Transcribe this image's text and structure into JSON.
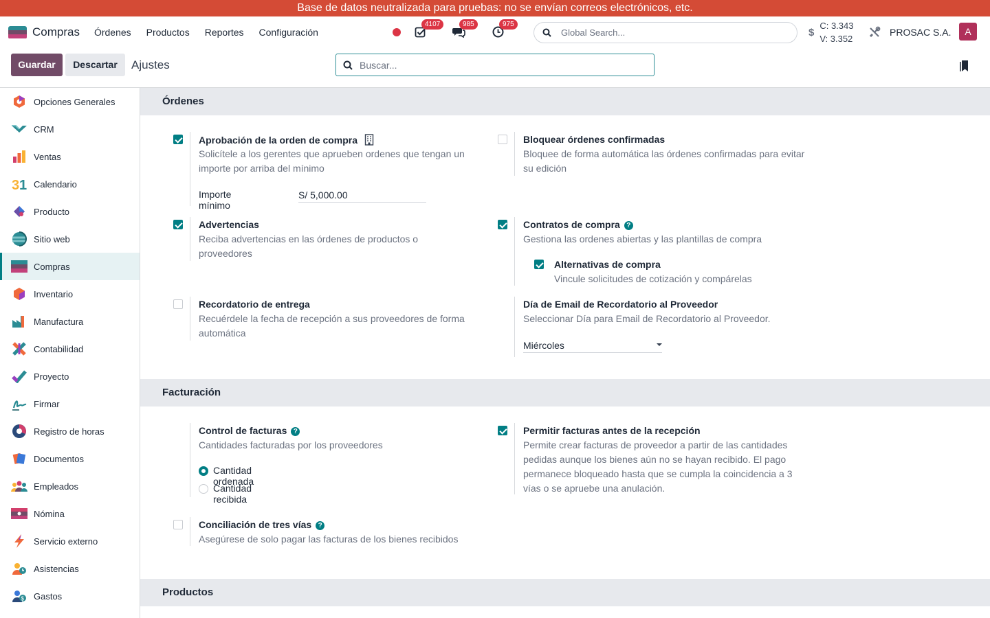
{
  "banner": {
    "text": "Base de datos neutralizada para pruebas: no se envían correos electrónicos, etc."
  },
  "navbar": {
    "app_name": "Compras",
    "menu": [
      "Órdenes",
      "Productos",
      "Reportes",
      "Configuración"
    ],
    "badges": {
      "activities": "4107",
      "messages": "985",
      "clock": "975"
    },
    "global_search_placeholder": "Global Search...",
    "currency_symbol": "$",
    "rate_buy": "C: 3.343",
    "rate_sell": "V: 3.352",
    "company": "PROSAC S.A.",
    "avatar_initial": "A"
  },
  "controlbar": {
    "save": "Guardar",
    "discard": "Descartar",
    "breadcrumb": "Ajustes",
    "search_placeholder": "Buscar..."
  },
  "sidebar": {
    "items": [
      {
        "label": "Opciones Generales",
        "icon": "general-options-icon"
      },
      {
        "label": "CRM",
        "icon": "crm-icon"
      },
      {
        "label": "Ventas",
        "icon": "sales-icon"
      },
      {
        "label": "Calendario",
        "icon": "calendar-icon"
      },
      {
        "label": "Producto",
        "icon": "product-icon"
      },
      {
        "label": "Sitio web",
        "icon": "website-icon"
      },
      {
        "label": "Compras",
        "icon": "purchase-icon"
      },
      {
        "label": "Inventario",
        "icon": "inventory-icon"
      },
      {
        "label": "Manufactura",
        "icon": "manufacturing-icon"
      },
      {
        "label": "Contabilidad",
        "icon": "accounting-icon"
      },
      {
        "label": "Proyecto",
        "icon": "project-icon"
      },
      {
        "label": "Firmar",
        "icon": "sign-icon"
      },
      {
        "label": "Registro de horas",
        "icon": "timesheet-icon"
      },
      {
        "label": "Documentos",
        "icon": "documents-icon"
      },
      {
        "label": "Empleados",
        "icon": "employees-icon"
      },
      {
        "label": "Nómina",
        "icon": "payroll-icon"
      },
      {
        "label": "Servicio externo",
        "icon": "field-service-icon"
      },
      {
        "label": "Asistencias",
        "icon": "attendances-icon"
      },
      {
        "label": "Gastos",
        "icon": "expenses-icon"
      }
    ],
    "active": "Compras"
  },
  "sections": {
    "orders": {
      "title": "Órdenes",
      "po_approval": {
        "title": "Aprobación de la orden de compra",
        "desc": "Solicítele a los gerentes que aprueben ordenes que tengan un importe por arriba del mínimo",
        "checked": true,
        "min_label": "Importe mínimo",
        "min_value": "S/ 5,000.00"
      },
      "lock_orders": {
        "title": "Bloquear órdenes confirmadas",
        "desc": "Bloquee de forma automática las órdenes confirmadas para evitar su edición",
        "checked": false
      },
      "warnings": {
        "title": "Advertencias",
        "desc": "Reciba advertencias en las órdenes de productos o proveedores",
        "checked": true
      },
      "agreements": {
        "title": "Contratos de compra",
        "desc": "Gestiona las ordenes abiertas y las plantillas de compra",
        "checked": true
      },
      "alternatives": {
        "title": "Alternativas de compra",
        "desc": "Vincule solicitudes de cotización y compárelas",
        "checked": true
      },
      "receipt_reminder": {
        "title": "Recordatorio de entrega",
        "desc": "Recuérdele la fecha de recepción a sus proveedores de forma automática",
        "checked": false
      },
      "reminder_day": {
        "title": "Día de Email de Recordatorio al Proveedor",
        "desc": "Seleccionar Día para Email de Recordatorio al Proveedor.",
        "value": "Miércoles"
      }
    },
    "billing": {
      "title": "Facturación",
      "bill_control": {
        "title": "Control de facturas",
        "desc": "Cantidades facturadas por los proveedores",
        "options": [
          "Cantidad ordenada",
          "Cantidad recibida"
        ],
        "selected": "Cantidad ordenada"
      },
      "bills_before_receipt": {
        "title": "Permitir facturas antes de la recepción",
        "desc": "Permite crear facturas de proveedor a partir de las cantidades pedidas aunque los bienes aún no se hayan recibido. El pago permanece bloqueado hasta que se cumpla la coincidencia a 3 vías o se apruebe una anulación.",
        "checked": true
      },
      "three_way": {
        "title": "Conciliación de tres vías",
        "desc": "Asegúrese de solo pagar las facturas de los bienes recibidos",
        "checked": false
      }
    },
    "products": {
      "title": "Productos"
    }
  },
  "colors": {
    "primary": "#714b67",
    "accent": "#017e84",
    "banner": "#d44b36",
    "badge": "#dc3545"
  }
}
